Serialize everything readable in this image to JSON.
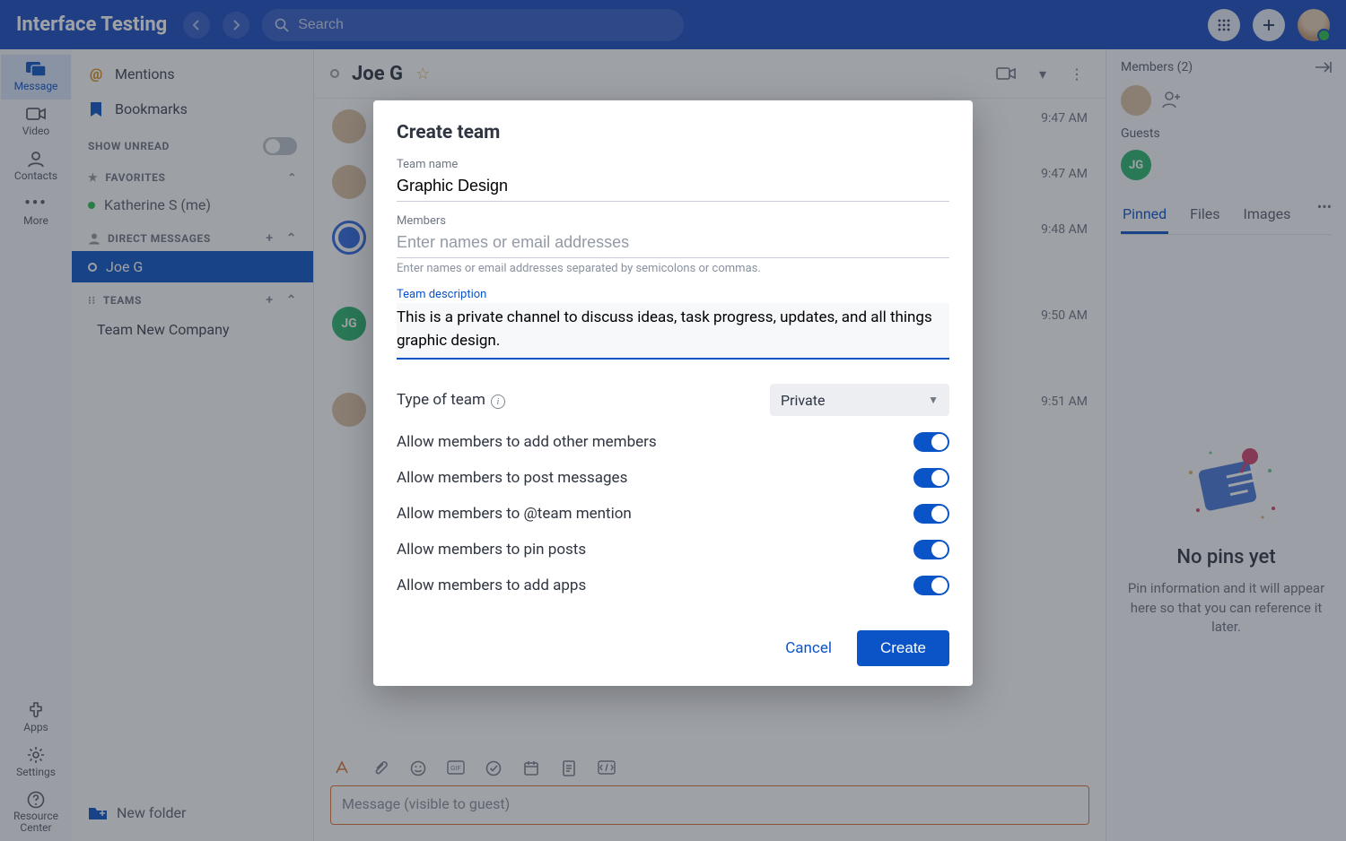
{
  "app": {
    "title": "Interface Testing",
    "search_placeholder": "Search"
  },
  "rail": {
    "message": "Message",
    "video": "Video",
    "contacts": "Contacts",
    "more": "More",
    "apps": "Apps",
    "settings": "Settings",
    "resource_center": "Resource\nCenter"
  },
  "sidebar": {
    "mentions": "Mentions",
    "bookmarks": "Bookmarks",
    "show_unread": "SHOW UNREAD",
    "favorites": "FAVORITES",
    "fav_me": "Katherine S (me)",
    "direct_messages": "DIRECT MESSAGES",
    "dm_active": "Joe G",
    "teams": "TEAMS",
    "team1": "Team New Company",
    "new_folder": "New folder"
  },
  "chat": {
    "title": "Joe G",
    "times": {
      "t1": "9:47 AM",
      "t2": "9:47 AM",
      "t3": "9:48 AM",
      "t4": "9:50 AM",
      "t5": "9:51 AM"
    },
    "green_initials": "JG",
    "composer_placeholder": "Message (visible to guest)"
  },
  "right": {
    "members_label": "Members (2)",
    "guests": "Guests",
    "guest_initials": "JG",
    "tabs": {
      "pinned": "Pinned",
      "files": "Files",
      "images": "Images"
    },
    "empty_title": "No pins yet",
    "empty_body": "Pin information and it will appear here so that you can reference it later."
  },
  "modal": {
    "title": "Create team",
    "team_name_label": "Team name",
    "team_name_value": "Graphic Design",
    "members_label": "Members",
    "members_placeholder": "Enter names or email addresses",
    "members_hint": "Enter names or email addresses separated by semicolons or commas.",
    "desc_label": "Team description",
    "desc_value": "This is a private channel to discuss ideas, task progress, updates, and all things graphic design.",
    "type_label": "Type of team",
    "type_value": "Private",
    "perm_add_members": "Allow members to add other members",
    "perm_post": "Allow members to post messages",
    "perm_mention": "Allow members to @team mention",
    "perm_pin": "Allow members to pin posts",
    "perm_apps": "Allow members to add apps",
    "cancel": "Cancel",
    "create": "Create"
  }
}
